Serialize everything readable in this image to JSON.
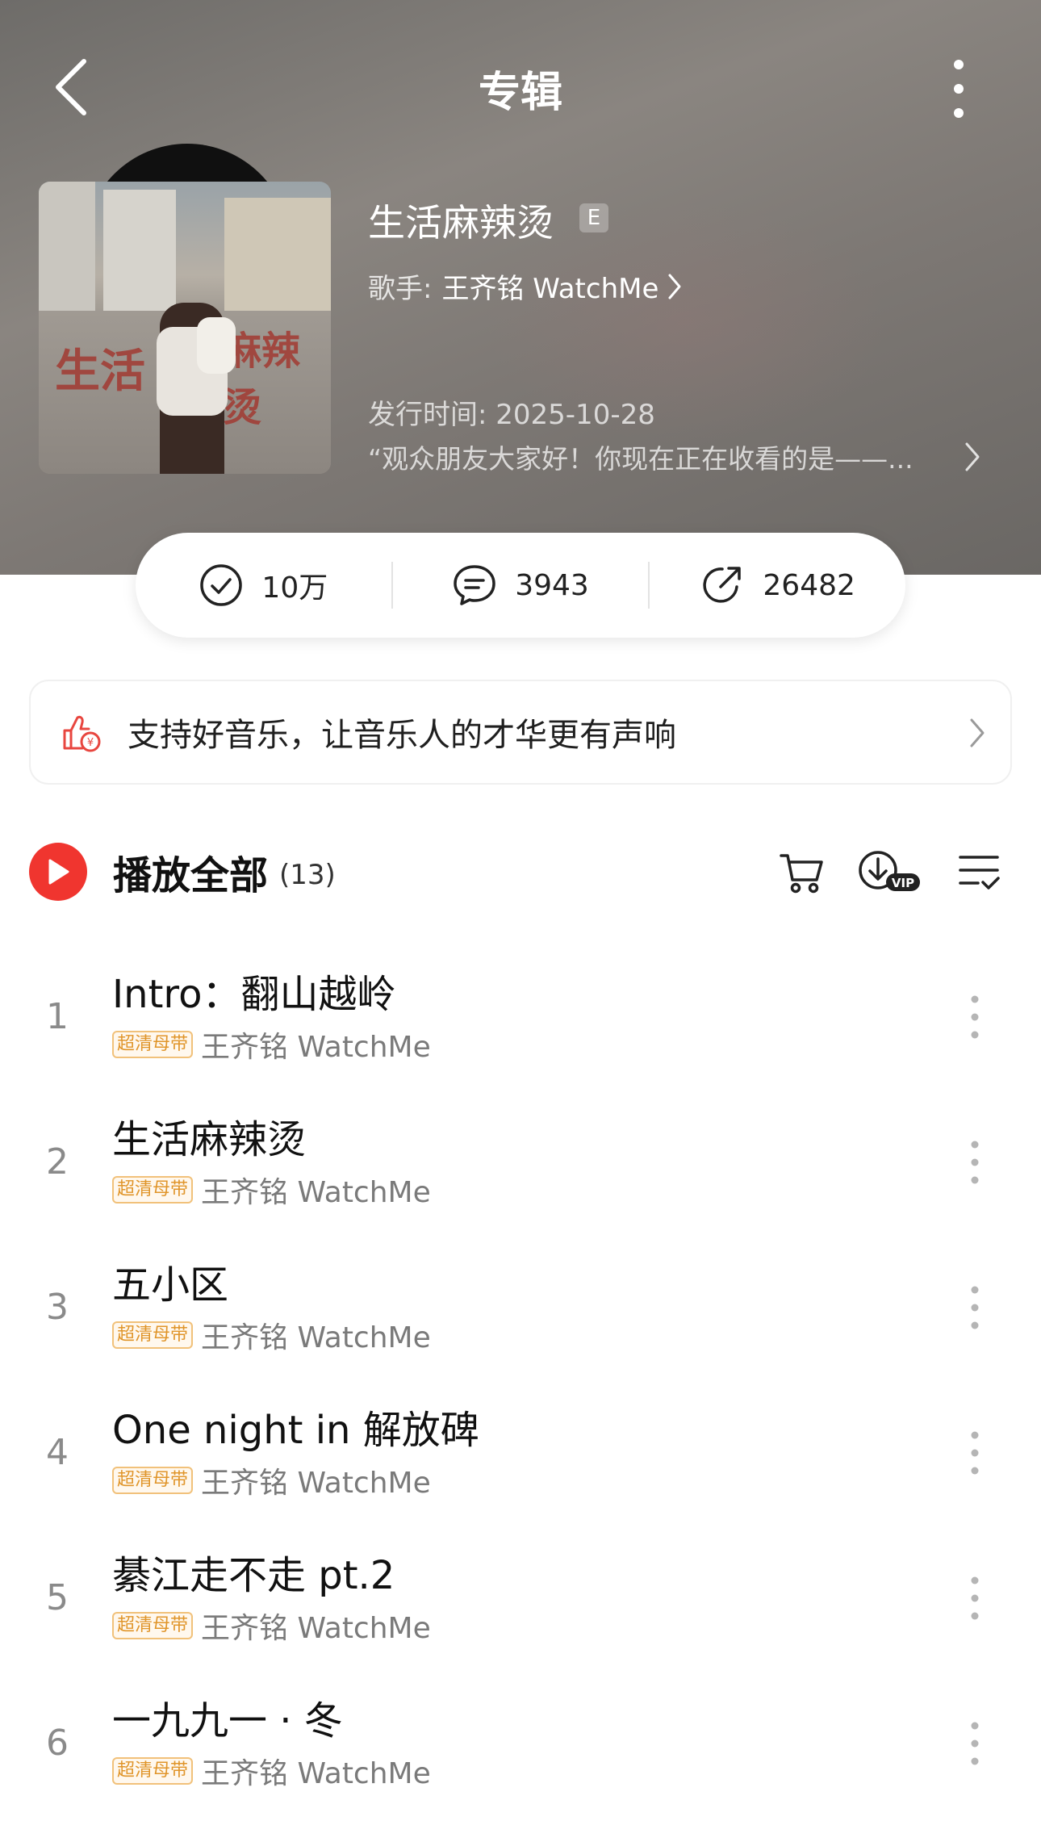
{
  "header": {
    "title": "专辑",
    "back_icon": "chevron-left-icon",
    "more_icon": "vertical-dots-icon"
  },
  "album": {
    "title": "生活麻辣烫",
    "explicit_badge": "E",
    "artist_label": "歌手:",
    "artist_name": "王齐铭 WatchMe",
    "release": "发行时间: 2025-10-28",
    "description": "“观众朋友大家好！你现在正在收看的是——...",
    "cover_art_text": [
      "生活",
      "麻辣烫"
    ]
  },
  "stats": {
    "collect": "10万",
    "comments": "3943",
    "shares": "26482"
  },
  "support_banner": {
    "text": "支持好音乐，让音乐人的才华更有声响"
  },
  "play_all": {
    "label": "播放全部",
    "count": "(13)"
  },
  "tracks": [
    {
      "num": "1",
      "title": "Intro：翻山越岭",
      "badge": "超清母带",
      "artist": "王齐铭 WatchMe"
    },
    {
      "num": "2",
      "title": "生活麻辣烫",
      "badge": "超清母带",
      "artist": "王齐铭 WatchMe"
    },
    {
      "num": "3",
      "title": "五小区",
      "badge": "超清母带",
      "artist": "王齐铭 WatchMe"
    },
    {
      "num": "4",
      "title": "One night in 解放碑",
      "badge": "超清母带",
      "artist": "王齐铭 WatchMe"
    },
    {
      "num": "5",
      "title": "綦江走不走 pt.2",
      "badge": "超清母带",
      "artist": "王齐铭 WatchMe"
    },
    {
      "num": "6",
      "title": "一九九一 · 冬",
      "badge": "超清母带",
      "artist": "王齐铭 WatchMe"
    }
  ],
  "colors": {
    "accent_red": "#f0352f",
    "badge_gold": "#e0952a"
  }
}
